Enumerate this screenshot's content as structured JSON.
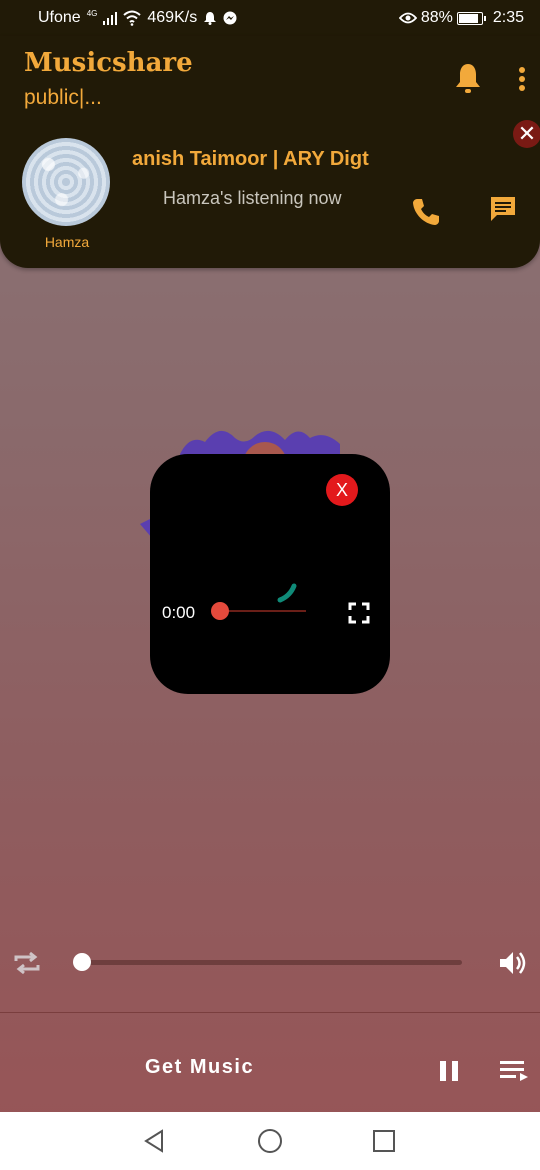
{
  "status_bar": {
    "carrier": "Ufone",
    "network": "4G",
    "speed": "469K/s",
    "battery": "88%",
    "time": "2:35"
  },
  "header": {
    "app_title": "Musicshare",
    "room": "public|...",
    "song_title": "anish Taimoor | ARY Digt",
    "status_text": "Hamza's listening now",
    "user_name": "Hamza"
  },
  "video": {
    "close_label": "X",
    "time": "0:00"
  },
  "player": {
    "progress": 0,
    "get_music_label": "Get Music"
  },
  "colors": {
    "accent": "#f2a93b",
    "header_bg": "#211a07",
    "video_close": "#e3191c"
  },
  "icons": [
    "bell-icon",
    "more-vert-icon",
    "close-icon",
    "phone-icon",
    "chat-icon",
    "fullscreen-icon",
    "repeat-icon",
    "volume-icon",
    "pause-icon",
    "queue-icon",
    "back-icon",
    "home-icon",
    "recents-icon"
  ]
}
